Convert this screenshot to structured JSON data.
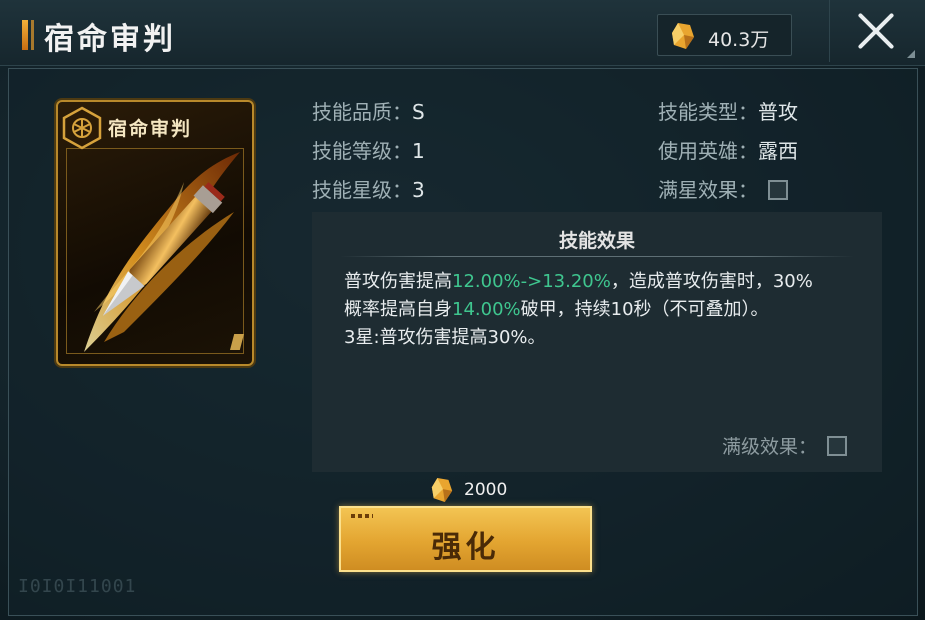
{
  "header": {
    "title": "宿命审判",
    "currency_amount": "40.3万"
  },
  "card": {
    "name": "宿命审判"
  },
  "info": {
    "quality_label": "技能品质：",
    "quality_value": "S",
    "level_label": "技能等级：",
    "level_value": "1",
    "star_label": "技能星级：",
    "star_value": "3",
    "type_label": "技能类型：",
    "type_value": "普攻",
    "hero_label": "使用英雄：",
    "hero_value": "露西",
    "max_star_label": "满星效果："
  },
  "effect": {
    "title": "技能效果",
    "line1_a": "普攻伤害提高",
    "line1_b": "12.00%->13.20%",
    "line1_c": "，造成普攻伤害时，30%",
    "line2_a": "概率提高自身",
    "line2_b": "14.00%",
    "line2_c": "破甲，持续10秒（不可叠加）。",
    "line3": "3星:普攻伤害提高30%。",
    "max_level_label": "满级效果："
  },
  "upgrade": {
    "cost": "2000",
    "button_label": "强化"
  },
  "footer": {
    "code": "I0I0I11001"
  },
  "colors": {
    "highlight": "#3fc68f",
    "button_gold": "#e3a531"
  }
}
